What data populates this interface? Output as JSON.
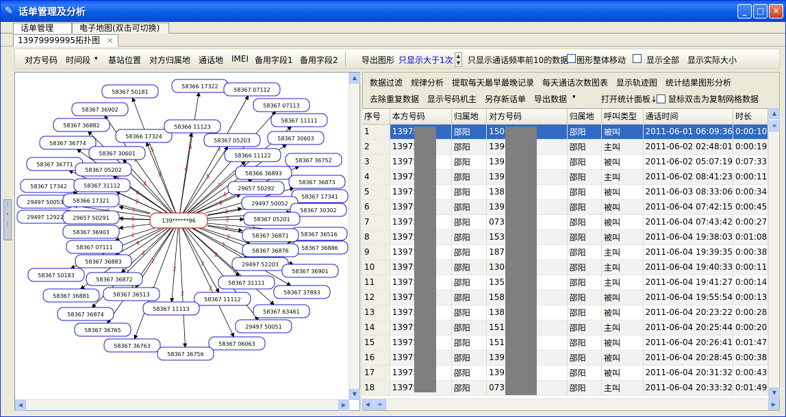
{
  "window": {
    "title": "话单管理及分析"
  },
  "top_tabs": [
    "话单管理",
    "电子地图(双击可切换)"
  ],
  "doc_tab": {
    "label": "13979999995拓扑图",
    "close": "×"
  },
  "toolbar": {
    "items": [
      "对方号码",
      "时间段",
      "基站位置",
      "对方归属地",
      "通话地",
      "IMEI",
      "备用字段1",
      "备用字段2"
    ],
    "dropdown_arrow": "▾",
    "export_graph": "导出图形",
    "only_show_gt1": "只显示大于1次",
    "top10": "只显示通话频率前10的数据",
    "graph_move": "图形整体移动",
    "show_all": "显示全部",
    "show_actual": "显示实际大小"
  },
  "right_toolbar": {
    "row1": [
      "数据过滤",
      "规律分析",
      "提取每天最早最晚记录",
      "每天通话次数图表",
      "显示轨迹图",
      "统计结果图形分析"
    ],
    "row2": [
      "去除重复数据",
      "显示号码机主",
      "另存新话单",
      "导出数据",
      "打开统计面板↓"
    ],
    "copy_grid": "鼠标双击为复制网格数据"
  },
  "graph": {
    "center": "139******96",
    "nodes": [
      {
        "label": "58366 17322",
        "count": "5"
      },
      {
        "label": "58367 07112",
        "count": "3"
      },
      {
        "label": "58367 50181",
        "count": "5"
      },
      {
        "label": "58367 07113",
        "count": "3"
      },
      {
        "label": "58367 36902",
        "count": "2"
      },
      {
        "label": "58367 11111",
        "count": "2"
      },
      {
        "label": "58367 36882",
        "count": "3"
      },
      {
        "label": "58366 17324",
        "count": "3"
      },
      {
        "label": "58366 11123",
        "count": "4"
      },
      {
        "label": "58367 05203",
        "count": "5"
      },
      {
        "label": "58367 30603",
        "count": "2"
      },
      {
        "label": "58367 36774",
        "count": "3"
      },
      {
        "label": "58367 30601",
        "count": "4"
      },
      {
        "label": "58366 11122",
        "count": "3"
      },
      {
        "label": "58367 36752",
        "count": "2"
      },
      {
        "label": "58367 36771",
        "count": "3"
      },
      {
        "label": "58367 05202",
        "count": "4"
      },
      {
        "label": "58366 36893",
        "count": "5"
      },
      {
        "label": "58367 36873",
        "count": "3"
      },
      {
        "label": "58367 17342",
        "count": "2"
      },
      {
        "label": "58367 31112",
        "count": "2"
      },
      {
        "label": "29657 50292",
        "count": "6"
      },
      {
        "label": "58367 17341",
        "count": "2"
      },
      {
        "label": "29497 50053",
        "count": "3"
      },
      {
        "label": "58366 17321",
        "count": "3"
      },
      {
        "label": "29497 50052",
        "count": "2"
      },
      {
        "label": "58367 30302",
        "count": "2"
      },
      {
        "label": "29497 12922",
        "count": "2"
      },
      {
        "label": "29657 50291",
        "count": "5"
      },
      {
        "label": "58367 05201",
        "count": "2"
      },
      {
        "label": "58367 36516",
        "count": "2"
      },
      {
        "label": "58367 36903",
        "count": "2"
      },
      {
        "label": "58367 36871",
        "count": "2"
      },
      {
        "label": "58367 36886",
        "count": "3"
      },
      {
        "label": "58367 07111",
        "count": "2"
      },
      {
        "label": "58367 36876",
        "count": "2"
      },
      {
        "label": "58367 36883",
        "count": "4"
      },
      {
        "label": "29497 52203",
        "count": "3"
      },
      {
        "label": "58367 36901",
        "count": "3"
      },
      {
        "label": "58367 50183",
        "count": "3"
      },
      {
        "label": "58367 36872",
        "count": "2"
      },
      {
        "label": "58367 31111",
        "count": "2"
      },
      {
        "label": "58367 37893",
        "count": "2"
      },
      {
        "label": "58367 36881",
        "count": "2"
      },
      {
        "label": "58367 36513",
        "count": "2"
      },
      {
        "label": "58367 11112",
        "count": "2"
      },
      {
        "label": "58367 36874",
        "count": "2"
      },
      {
        "label": "58367 11113",
        "count": "2"
      },
      {
        "label": "58367 63461",
        "count": "2"
      },
      {
        "label": "58367 36765",
        "count": "2"
      },
      {
        "label": "29497 50051",
        "count": "2"
      },
      {
        "label": "58367 36763",
        "count": "2"
      },
      {
        "label": "58367 06063",
        "count": "2"
      },
      {
        "label": "58367 36756",
        "count": "2"
      }
    ]
  },
  "table": {
    "columns": [
      "序号",
      "本方号码",
      "归属地",
      "对方号码",
      "归属地",
      "呼叫类型",
      "通话时间",
      "时长"
    ],
    "rows": [
      [
        "1",
        "13975",
        "邵阳",
        "1500",
        "邵阳",
        "被叫",
        "2011-06-01 06:09:36",
        "0:00:10"
      ],
      [
        "2",
        "13975",
        "邵阳",
        "1390",
        "邵阳",
        "主叫",
        "2011-06-02 02:48:01",
        "0:00:19"
      ],
      [
        "3",
        "13975",
        "邵阳",
        "1397",
        "邵阳",
        "被叫",
        "2011-06-02 05:07:19",
        "0:07:33"
      ],
      [
        "4",
        "13975",
        "邵阳",
        "1397",
        "邵阳",
        "主叫",
        "2011-06-02 08:41:23",
        "0:00:11"
      ],
      [
        "5",
        "13975",
        "邵阳",
        "1387",
        "邵阳",
        "被叫",
        "2011-06-03 08:33:06",
        "0:00:34"
      ],
      [
        "6",
        "13975",
        "邵阳",
        "1397",
        "邵阳",
        "被叫",
        "2011-06-04 07:42:15",
        "0:00:45"
      ],
      [
        "7",
        "13975",
        "邵阳",
        "0739",
        "邵阳",
        "被叫",
        "2011-06-04 07:43:42",
        "0:00:27"
      ],
      [
        "8",
        "13975",
        "邵阳",
        "1538",
        "邵阳",
        "被叫",
        "2011-06-04 19:38:03",
        "0:01:08"
      ],
      [
        "9",
        "13975",
        "邵阳",
        "1877",
        "邵阳",
        "主叫",
        "2011-06-04 19:39:35",
        "0:00:38"
      ],
      [
        "10",
        "13975",
        "邵阳",
        "1308",
        "邵阳",
        "主叫",
        "2011-06-04 19:40:33",
        "0:00:11"
      ],
      [
        "11",
        "13975",
        "邵阳",
        "1357",
        "邵阳",
        "主叫",
        "2011-06-04 19:41:27",
        "0:00:14"
      ],
      [
        "12",
        "13975",
        "邵阳",
        "1587",
        "邵阳",
        "被叫",
        "2011-06-04 19:55:54",
        "0:00:13"
      ],
      [
        "13",
        "13975",
        "邵阳",
        "1387",
        "邵阳",
        "被叫",
        "2011-06-04 20:23:22",
        "0:00:28"
      ],
      [
        "14",
        "13975",
        "邵阳",
        "1511",
        "邵阳",
        "主叫",
        "2011-06-04 20:25:44",
        "0:00:20"
      ],
      [
        "15",
        "13975",
        "邵阳",
        "1511",
        "邵阳",
        "被叫",
        "2011-06-04 20:26:41",
        "0:01:47"
      ],
      [
        "16",
        "13975",
        "邵阳",
        "1397",
        "邵阳",
        "被叫",
        "2011-06-04 20:28:45",
        "0:00:38"
      ],
      [
        "17",
        "13975",
        "邵阳",
        "1397",
        "邵阳",
        "被叫",
        "2011-06-04 20:31:32",
        "0:00:43"
      ],
      [
        "18",
        "13975",
        "邵阳",
        "0739",
        "邵阳",
        "主叫",
        "2011-06-04 20:33:32",
        "0:01:49"
      ]
    ]
  },
  "colors": {
    "title_bar": "#0a58f0",
    "selection": "#316ac5",
    "node_border": "#1a1acc",
    "edge_label": "#dd0000"
  }
}
